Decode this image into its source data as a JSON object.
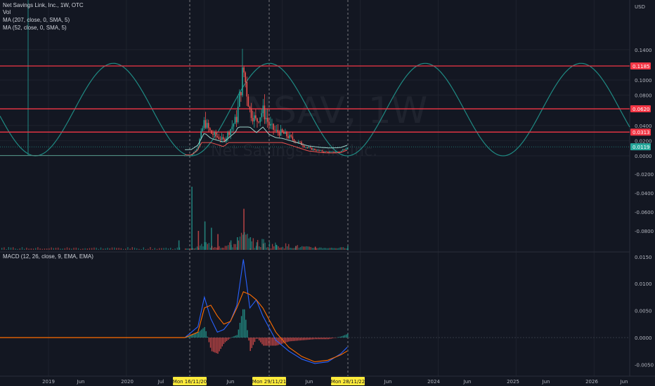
{
  "header": {
    "symbol_line": "Net Savings Link, Inc., 1W, OTC",
    "vol_label": "Vol",
    "ma1_label": "MA (207, close, 0, SMA, 5)",
    "ma2_label": "MA (52, close, 0, SMA, 5)",
    "macd_label": "MACD (12, 26, close, 9, EMA, EMA)",
    "currency": "USD",
    "watermark_ticker": "NSAV, 1W",
    "watermark_name": "Net Savings Link, Inc."
  },
  "colors": {
    "background": "#131722",
    "up": "#26a69a",
    "down": "#ef5350",
    "cycle_line": "#1f8a83",
    "hline": "#f23645",
    "macd_line": "#2962ff",
    "signal_line": "#ff6d00",
    "date_badge": "#ffeb3b"
  },
  "chart_data": [
    {
      "type": "candlestick",
      "pane": "price",
      "y_unit": "USD",
      "ylim": [
        -0.002,
        0.152
      ],
      "price_ticks": [
        0.14,
        0.1,
        0.08,
        0.04,
        0.02,
        -0.0
      ],
      "price_ticks_lower": [
        -0.02,
        -0.04,
        -0.06,
        -0.08
      ],
      "horizontal_lines": [
        0.1185,
        0.062,
        0.0313
      ],
      "last_price": 0.0119,
      "cycle_line": {
        "peaks": [
          "2019-11",
          "2022-01",
          "2024-02",
          "2026-01"
        ],
        "troughs": [
          "2018-11",
          "2020-11",
          "2023-01",
          "2025-01"
        ],
        "peak_value": 0.122,
        "trough_value": 0.0
      },
      "series_weekly_close": [
        {
          "date": "2020-10",
          "value": 0.0003
        },
        {
          "date": "2020-11",
          "value": 0.0005
        },
        {
          "date": "2020-12",
          "value": 0.012
        },
        {
          "date": "2021-01",
          "value": 0.045
        },
        {
          "date": "2021-02",
          "value": 0.03
        },
        {
          "date": "2021-03",
          "value": 0.025
        },
        {
          "date": "2021-04",
          "value": 0.02
        },
        {
          "date": "2021-05",
          "value": 0.035
        },
        {
          "date": "2021-06",
          "value": 0.05
        },
        {
          "date": "2021-07",
          "value": 0.115
        },
        {
          "date": "2021-08",
          "value": 0.06
        },
        {
          "date": "2021-09",
          "value": 0.045
        },
        {
          "date": "2021-10",
          "value": 0.06
        },
        {
          "date": "2021-11",
          "value": 0.04
        },
        {
          "date": "2021-12",
          "value": 0.032
        },
        {
          "date": "2022-01",
          "value": 0.03
        },
        {
          "date": "2022-02",
          "value": 0.025
        },
        {
          "date": "2022-03",
          "value": 0.02
        },
        {
          "date": "2022-04",
          "value": 0.015
        },
        {
          "date": "2022-05",
          "value": 0.01
        },
        {
          "date": "2022-06",
          "value": 0.008
        },
        {
          "date": "2022-07",
          "value": 0.006
        },
        {
          "date": "2022-08",
          "value": 0.005
        },
        {
          "date": "2022-09",
          "value": 0.005
        },
        {
          "date": "2022-10",
          "value": 0.006
        },
        {
          "date": "2022-11",
          "value": 0.0119
        }
      ]
    },
    {
      "type": "bar",
      "pane": "volume",
      "series_name": "Vol",
      "dates": [
        "2020-09",
        "2020-11",
        "2020-12",
        "2021-01",
        "2021-02",
        "2021-03",
        "2021-05",
        "2021-06",
        "2021-07",
        "2021-08",
        "2021-09",
        "2021-10",
        "2021-12",
        "2022-03",
        "2022-06",
        "2022-11"
      ],
      "values": [
        0.15,
        1.0,
        0.3,
        0.45,
        0.35,
        0.25,
        0.15,
        0.2,
        0.65,
        0.2,
        0.12,
        0.1,
        0.08,
        0.06,
        0.05,
        0.06
      ]
    },
    {
      "type": "line",
      "pane": "macd",
      "ylim": [
        -0.0058,
        0.0162
      ],
      "ticks": [
        0.015,
        0.01,
        0.005,
        -0.0,
        -0.005
      ],
      "series": [
        {
          "name": "MACD",
          "x": [
            "2020-10",
            "2020-12",
            "2021-01",
            "2021-02",
            "2021-03",
            "2021-04",
            "2021-05",
            "2021-06",
            "2021-07",
            "2021-08",
            "2021-09",
            "2021-10",
            "2021-12",
            "2022-02",
            "2022-04",
            "2022-06",
            "2022-08",
            "2022-10",
            "2022-11"
          ],
          "y": [
            0.0,
            0.002,
            0.0075,
            0.0035,
            0.001,
            0.0015,
            0.003,
            0.006,
            0.0145,
            0.0055,
            0.007,
            0.004,
            -0.0005,
            -0.0025,
            -0.004,
            -0.0048,
            -0.0045,
            -0.003,
            -0.0018
          ]
        },
        {
          "name": "Signal",
          "x": [
            "2020-10",
            "2020-12",
            "2021-01",
            "2021-02",
            "2021-03",
            "2021-04",
            "2021-05",
            "2021-06",
            "2021-07",
            "2021-08",
            "2021-09",
            "2021-10",
            "2021-12",
            "2022-02",
            "2022-04",
            "2022-06",
            "2022-08",
            "2022-10",
            "2022-11"
          ],
          "y": [
            0.0,
            0.001,
            0.0055,
            0.006,
            0.004,
            0.0025,
            0.003,
            0.0055,
            0.0085,
            0.008,
            0.007,
            0.0055,
            0.001,
            -0.0018,
            -0.0035,
            -0.0045,
            -0.0042,
            -0.0032,
            -0.0025
          ]
        }
      ]
    }
  ],
  "x_axis": {
    "labels": [
      {
        "text": "2019",
        "badge": false,
        "tx": 69
      },
      {
        "text": "Jun",
        "badge": false,
        "tx": 115
      },
      {
        "text": "2020",
        "badge": false,
        "tx": 181
      },
      {
        "text": "Jul",
        "badge": false,
        "tx": 229
      },
      {
        "text": "Mon 16/11/20",
        "badge": true,
        "tx": 270
      },
      {
        "text": "Jun",
        "badge": false,
        "tx": 328
      },
      {
        "text": "Mon 29/11/21",
        "badge": true,
        "tx": 383
      },
      {
        "text": "Jun",
        "badge": false,
        "tx": 440
      },
      {
        "text": "Mon 28/11/22",
        "badge": true,
        "tx": 495
      },
      {
        "text": "Jun",
        "badge": false,
        "tx": 552
      },
      {
        "text": "2024",
        "badge": false,
        "tx": 617
      },
      {
        "text": "Jun",
        "badge": false,
        "tx": 665
      },
      {
        "text": "2025",
        "badge": false,
        "tx": 730
      },
      {
        "text": "Jun",
        "badge": false,
        "tx": 777
      },
      {
        "text": "2026",
        "badge": false,
        "tx": 842
      },
      {
        "text": "Jun",
        "badge": false,
        "tx": 888
      }
    ]
  },
  "price_labels": {
    "line1": "0.1185",
    "line2": "0.0620",
    "line3": "0.0313",
    "last": "0.0119"
  }
}
